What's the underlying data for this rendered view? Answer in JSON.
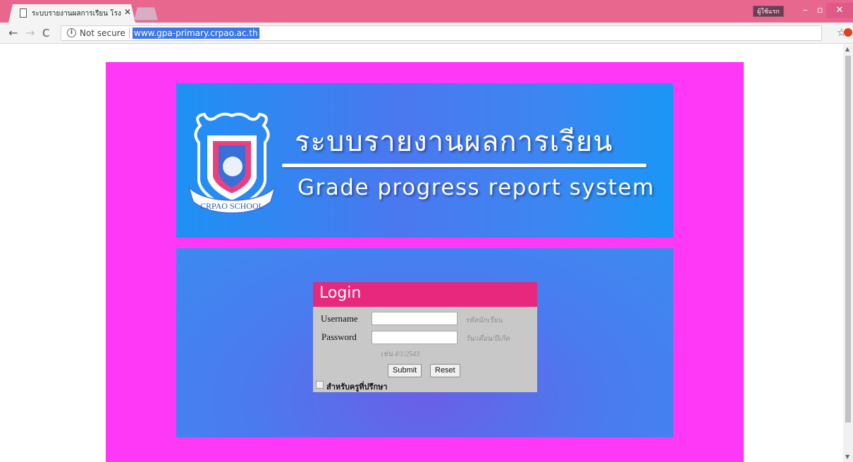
{
  "browser": {
    "tab_title": "ระบบรายงานผลการเรียน โรง",
    "user_badge": "ผู้ใช้แรก",
    "minimize": "–",
    "maximize": "▫",
    "close": "✕",
    "back_icon": "←",
    "forward_icon": "→",
    "reload_icon": "C",
    "info_icon": "i",
    "security_text": "Not secure",
    "url": "www.gpa-primary.crpao.ac.th",
    "star_icon": "☆"
  },
  "banner": {
    "title_th": "ระบบรายงานผลการเรียน",
    "title_en": "Grade progress report system",
    "crest_ribbon": "CRPAO SCHOOL"
  },
  "login": {
    "title": "Login",
    "username_label": "Username",
    "username_hint": "รหัสนักเรียน",
    "username_value": "",
    "password_label": "Password",
    "password_hint": "วัน/เดือน/ปีเกิด",
    "password_value": "",
    "example_hint": "เช่น 4/1/2543",
    "submit_label": "Submit",
    "reset_label": "Reset",
    "teacher_label": "สำหรับครูที่ปรึกษา",
    "teacher_checked": false
  },
  "colors": {
    "chrome_accent": "#e8678f",
    "page_frame": "#ff37f7",
    "banner_blue": "#1d91f4",
    "login_header": "#e6297c",
    "login_body": "#c8c8c8"
  }
}
